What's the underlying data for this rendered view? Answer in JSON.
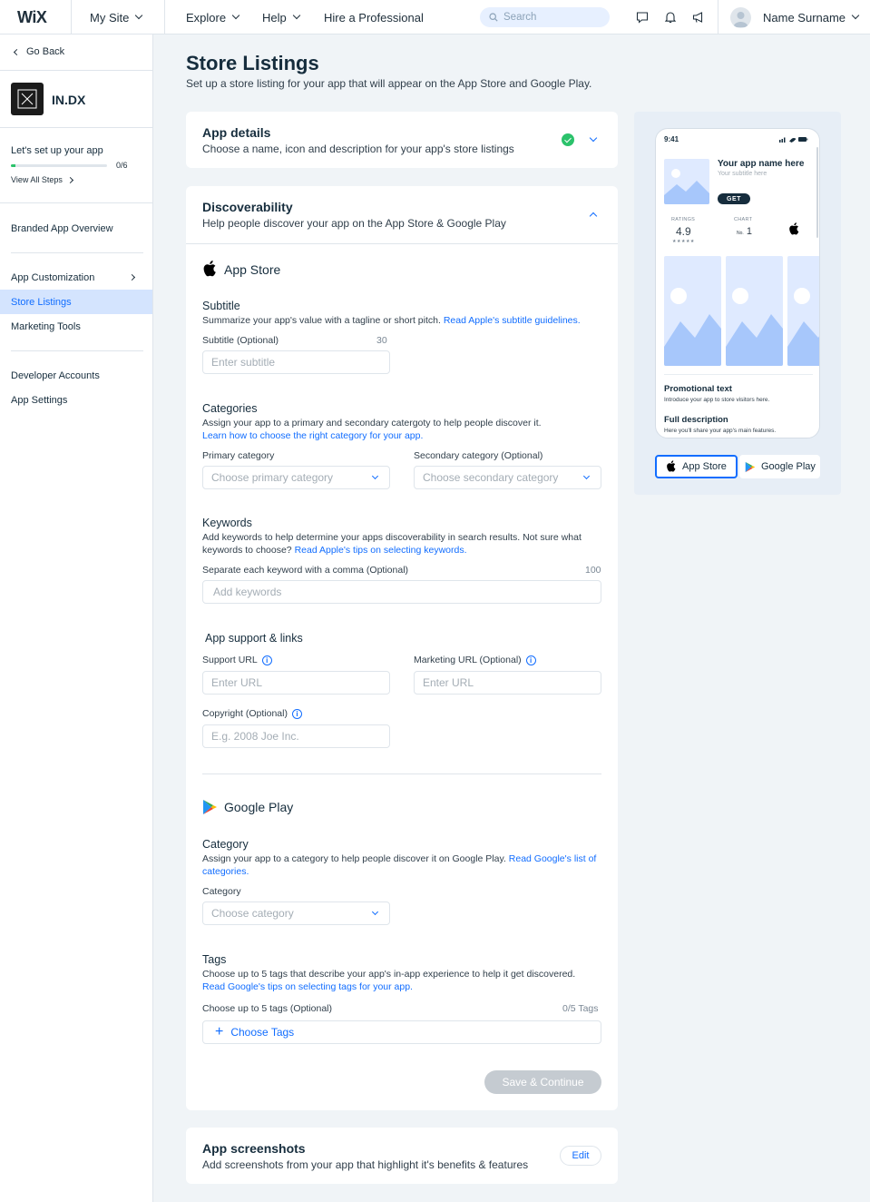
{
  "topbar": {
    "logo": "WiX",
    "my_site": "My Site",
    "explore": "Explore",
    "help": "Help",
    "hire": "Hire a Professional",
    "search_placeholder": "Search",
    "user_name": "Name Surname"
  },
  "sidebar": {
    "back": "Go Back",
    "app_name": "IN.DX",
    "setup_title": "Let's set up your app",
    "setup_progress": "0/6",
    "setup_fraction": 0.05,
    "view_steps": "View All Steps",
    "items": [
      {
        "label": "Branded App Overview"
      },
      {
        "label": "App Customization"
      },
      {
        "label": "Store Listings"
      },
      {
        "label": "Marketing Tools"
      },
      {
        "label": "Developer Accounts"
      },
      {
        "label": "App Settings"
      }
    ]
  },
  "page": {
    "title": "Store Listings",
    "subtitle": "Set up a store listing for your app that will appear on the App Store and Google Play."
  },
  "app_details": {
    "title": "App details",
    "subtitle": "Choose a name, icon and description for your app's store listings"
  },
  "discoverability": {
    "title": "Discoverability",
    "subtitle": "Help people discover your app on the App Store & Google Play",
    "app_store": {
      "heading": "App Store",
      "subtitle_title": "Subtitle",
      "subtitle_desc": "Summarize your app's value with a tagline or short pitch.",
      "subtitle_link": "Read Apple's subtitle guidelines.",
      "subtitle_label": "Subtitle (Optional)",
      "subtitle_count": "30",
      "subtitle_placeholder": "Enter subtitle",
      "categories_title": "Categories",
      "categories_desc": "Assign your app to a primary and secondary catergoty to help people discover it.",
      "categories_link": "Learn how to choose the right category for your app.",
      "primary_label": "Primary category",
      "primary_placeholder": "Choose primary category",
      "secondary_label": "Secondary category (Optional)",
      "secondary_placeholder": "Choose secondary category",
      "keywords_title": "Keywords",
      "keywords_desc": "Add keywords to help determine your apps discoverability in search results. Not sure what keywords to choose?",
      "keywords_link": "Read Apple's tips on selecting keywords.",
      "keywords_label": "Separate each keyword with a comma (Optional)",
      "keywords_count": "100",
      "keywords_placeholder": "Add keywords",
      "support_title": "App support & links",
      "support_url_label": "Support URL",
      "support_url_placeholder": "Enter URL",
      "marketing_url_label": "Marketing URL (Optional)",
      "marketing_url_placeholder": "Enter URL",
      "copyright_label": "Copyright (Optional)",
      "copyright_placeholder": "E.g. 2008 Joe Inc."
    },
    "google_play": {
      "heading": "Google Play",
      "category_title": "Category",
      "category_desc": "Assign your app to a category to help people discover it on Google Play.",
      "category_link": "Read Google's list of categories.",
      "category_label": "Category",
      "category_placeholder": "Choose category",
      "tags_title": "Tags",
      "tags_desc": "Choose up to 5 tags that describe your app's in-app experience to help it get discovered.",
      "tags_link": "Read Google's tips on selecting tags for your app.",
      "tags_label": "Choose up to 5 tags (Optional)",
      "tags_count": "0/5 Tags",
      "choose_tags": "Choose Tags"
    },
    "save_button": "Save & Continue"
  },
  "screenshots": {
    "title": "App screenshots",
    "subtitle": "Add screenshots from your app that highlight it's benefits & features",
    "edit": "Edit"
  },
  "preview": {
    "time": "9:41",
    "app_name": "Your app name here",
    "app_subtitle": "Your subtitle here",
    "get": "GET",
    "ratings_label": "RATINGS",
    "rating": "4.9",
    "stars": "★★★★★",
    "chart_label": "CHART",
    "chart_prefix": "No.",
    "chart_rank": "1",
    "promo_title": "Promotional text",
    "promo_desc": "Introduce your app to store visitors here.",
    "full_title": "Full description",
    "full_desc": "Here you'll share your app's main features.",
    "tab_app_store": "App Store",
    "tab_google_play": "Google Play"
  },
  "colors": {
    "accent": "#116dff",
    "success": "#2bc26b",
    "selected_bg": "#d4e4fe"
  }
}
